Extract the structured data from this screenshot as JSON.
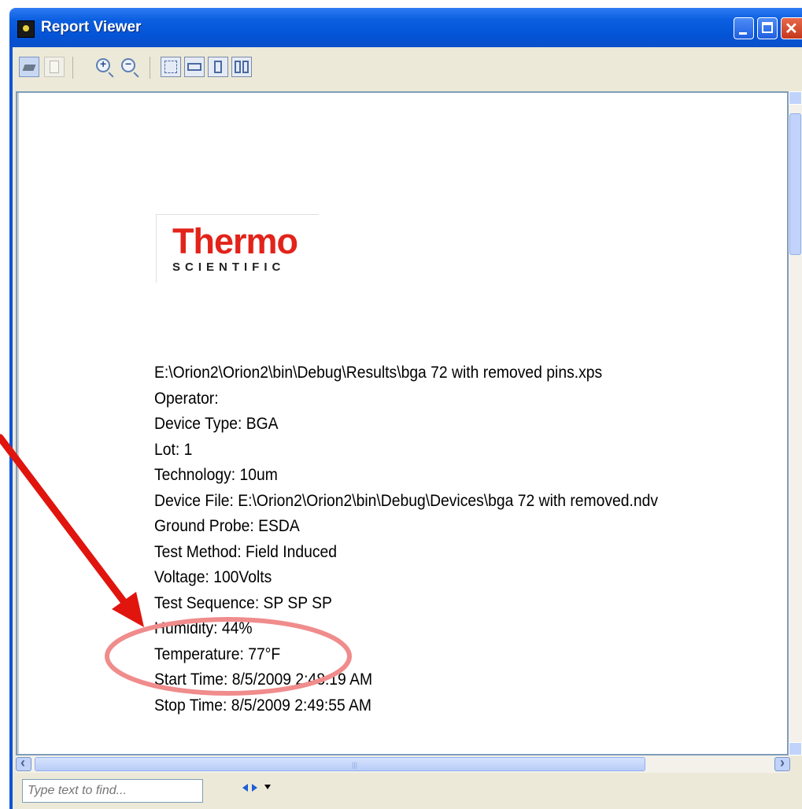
{
  "window": {
    "title": "Report Viewer"
  },
  "toolbar": {
    "buttons": [
      "print-icon",
      "copy-icon",
      "zoom-in-icon",
      "zoom-out-icon",
      "full-page-icon",
      "page-width-icon",
      "one-page-icon",
      "two-pages-icon"
    ]
  },
  "report": {
    "logo_main": "Thermo",
    "logo_sub": "SCIENTIFIC",
    "lines": [
      "E:\\Orion2\\Orion2\\bin\\Debug\\Results\\bga 72 with removed pins.xps",
      "Operator:",
      "Device Type:   BGA",
      "Lot:   1",
      "Technology:   10um",
      "Device File:   E:\\Orion2\\Orion2\\bin\\Debug\\Devices\\bga 72 with removed.ndv",
      "Ground Probe:   ESDA",
      "Test Method:   Field Induced",
      "Voltage:   100Volts",
      "Test Sequence:   SP  SP  SP",
      "Humidity:  44%",
      "Temperature:  77°F",
      "Start Time:   8/5/2009 2:48:19 AM",
      "Stop Time:    8/5/2009 2:49:55 AM"
    ]
  },
  "findbar": {
    "placeholder": "Type text to find..."
  },
  "colors": {
    "titlebar": "#0454d6",
    "annotation_arrow": "#e0150e",
    "annotation_ellipse": "#f08c8c",
    "logo_red": "#e2231a"
  }
}
